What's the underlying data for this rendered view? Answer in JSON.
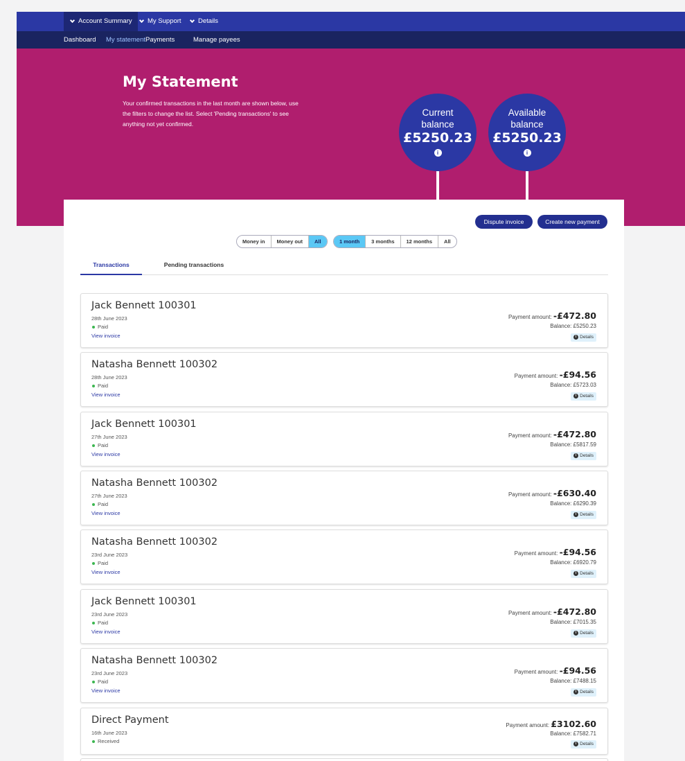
{
  "nav": {
    "top": [
      "Account Summary",
      "My Support",
      "Details"
    ],
    "sub": [
      "Dashboard",
      "My statement",
      "Payments",
      "Manage payees"
    ]
  },
  "hero": {
    "title": "My Statement",
    "description": "Your confirmed transactions in the last month are shown below, use the filters to change the list. Select 'Pending transactions' to see anything not yet confirmed.",
    "current_label": "Current balance",
    "current_amount": "£5250.23",
    "available_label": "Available balance",
    "available_amount": "£5250.23"
  },
  "actions": {
    "dispute": "Dispute invoice",
    "create": "Create new payment"
  },
  "filters": {
    "direction": [
      "Money in",
      "Money out",
      "All"
    ],
    "direction_selected": "All",
    "period": [
      "1 month",
      "3 months",
      "12 months",
      "All"
    ],
    "period_selected": "1 month"
  },
  "tabs": [
    "Transactions",
    "Pending transactions"
  ],
  "labels": {
    "payment_amount": "Payment amount:",
    "details": "Details",
    "view_invoice": "View invoice",
    "balance_prefix": "Balance: "
  },
  "transactions": [
    {
      "name": "Jack Bennett 100301",
      "date": "28th June 2023",
      "status": "Paid",
      "amount": "-£472.80",
      "balance": "£5250.23",
      "invoice": true
    },
    {
      "name": "Natasha Bennett 100302",
      "date": "28th June 2023",
      "status": "Paid",
      "amount": "-£94.56",
      "balance": "£5723.03",
      "invoice": true
    },
    {
      "name": "Jack Bennett 100301",
      "date": "27th June 2023",
      "status": "Paid",
      "amount": "-£472.80",
      "balance": "£5817.59",
      "invoice": true
    },
    {
      "name": "Natasha Bennett 100302",
      "date": "27th June 2023",
      "status": "Paid",
      "amount": "-£630.40",
      "balance": "£6290.39",
      "invoice": true
    },
    {
      "name": "Natasha Bennett 100302",
      "date": "23rd June 2023",
      "status": "Paid",
      "amount": "-£94.56",
      "balance": "£6920.79",
      "invoice": true
    },
    {
      "name": "Jack Bennett 100301",
      "date": "23rd June 2023",
      "status": "Paid",
      "amount": "-£472.80",
      "balance": "£7015.35",
      "invoice": true
    },
    {
      "name": "Natasha Bennett 100302",
      "date": "23rd June 2023",
      "status": "Paid",
      "amount": "-£94.56",
      "balance": "£7488.15",
      "invoice": true
    },
    {
      "name": "Direct Payment",
      "date": "16th June 2023",
      "status": "Received",
      "amount": "£3102.60",
      "balance": "£7582.71",
      "invoice": false
    }
  ]
}
